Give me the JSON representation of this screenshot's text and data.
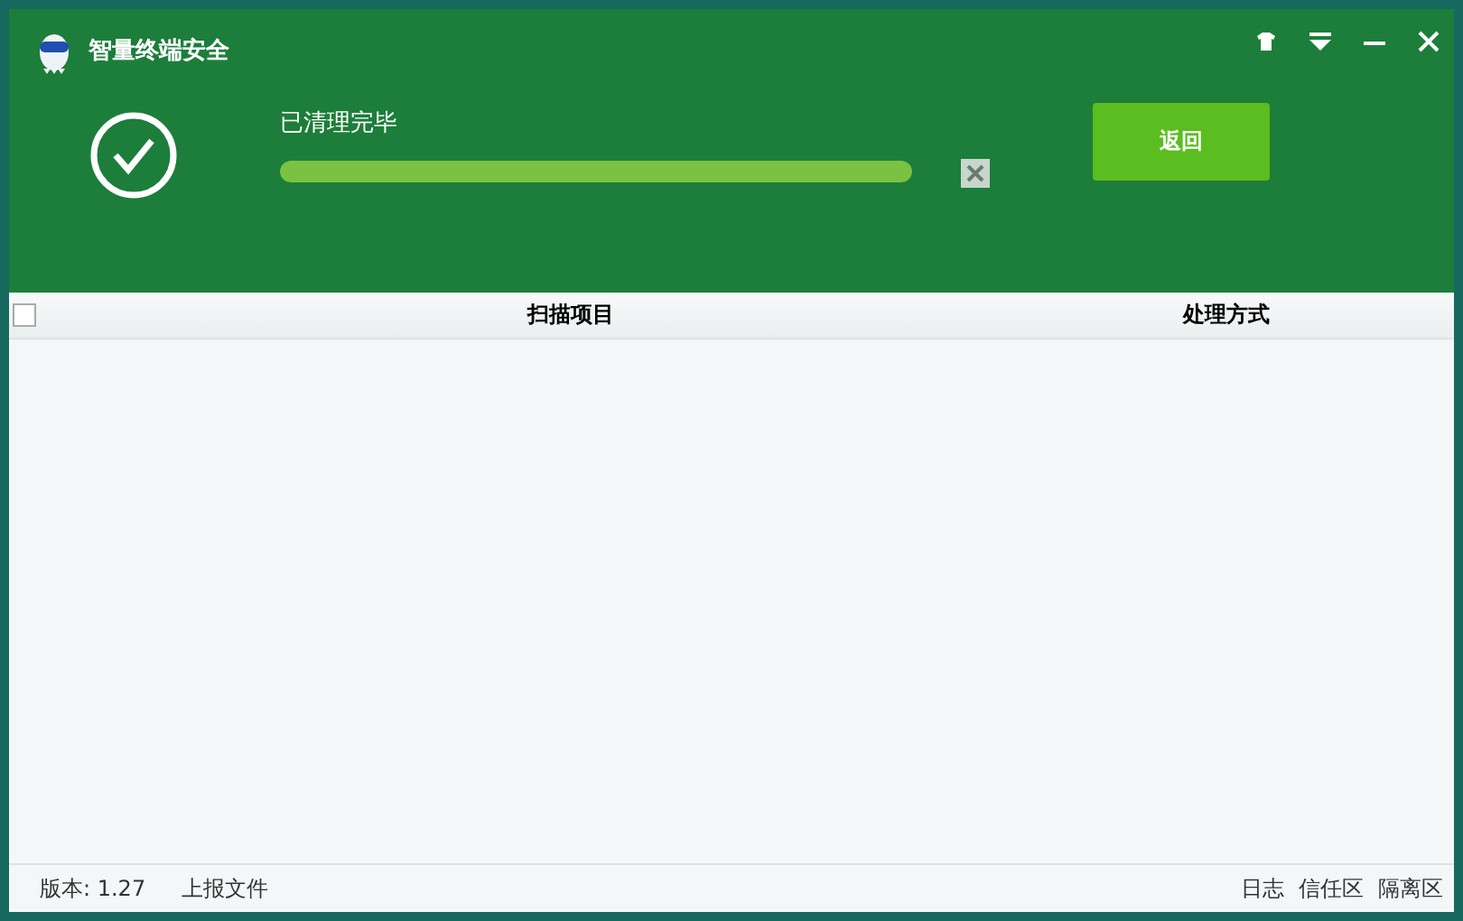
{
  "window": {
    "title": "智量终端安全"
  },
  "status": {
    "text": "已清理完毕",
    "level": 1
  },
  "return_button": "返回",
  "table": {
    "all_checked": false,
    "columns": [
      "扫描项目",
      "处理方式"
    ]
  },
  "status_bar": {
    "version": "版本: 1.27",
    "report": "上报文件",
    "links": [
      "日志",
      "信任区",
      "隔离区"
    ]
  }
}
